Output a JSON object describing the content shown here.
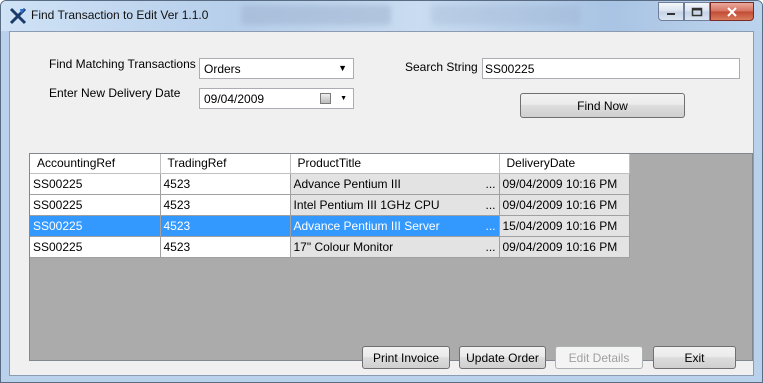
{
  "window": {
    "title": "Find Transaction to Edit Ver 1.1.0",
    "controls": [
      "minimize",
      "maximize",
      "close"
    ]
  },
  "form": {
    "find_label": "Find Matching Transactions",
    "find_value": "Orders",
    "search_label": "Search String",
    "search_value": "SS00225",
    "date_label": "Enter New Delivery Date",
    "date_value": "09/04/2009",
    "find_now": "Find Now"
  },
  "grid": {
    "columns": [
      "AccountingRef",
      "TradingRef",
      "ProductTitle",
      "DeliveryDate"
    ],
    "rows": [
      {
        "accounting_ref": "SS00225",
        "trading_ref": "4523",
        "product_title": "Advance  Pentium III",
        "delivery_date": "09/04/2009 10:16 PM",
        "selected": false
      },
      {
        "accounting_ref": "SS00225",
        "trading_ref": "4523",
        "product_title": "Intel Pentium III 1GHz  CPU",
        "delivery_date": "09/04/2009 10:16 PM",
        "selected": false
      },
      {
        "accounting_ref": "SS00225",
        "trading_ref": "4523",
        "product_title": "Advance Pentium III Server",
        "delivery_date": "15/04/2009 10:16 PM",
        "selected": true
      },
      {
        "accounting_ref": "SS00225",
        "trading_ref": "4523",
        "product_title": "17\" Colour Monitor",
        "delivery_date": "09/04/2009 10:16 PM",
        "selected": false
      }
    ],
    "ellipsis": "..."
  },
  "buttons": {
    "print_invoice": "Print Invoice",
    "update_order": "Update Order",
    "edit_details": "Edit Details",
    "exit": "Exit"
  },
  "colors": {
    "selection": "#3399ff",
    "grid_background": "#ababab"
  }
}
